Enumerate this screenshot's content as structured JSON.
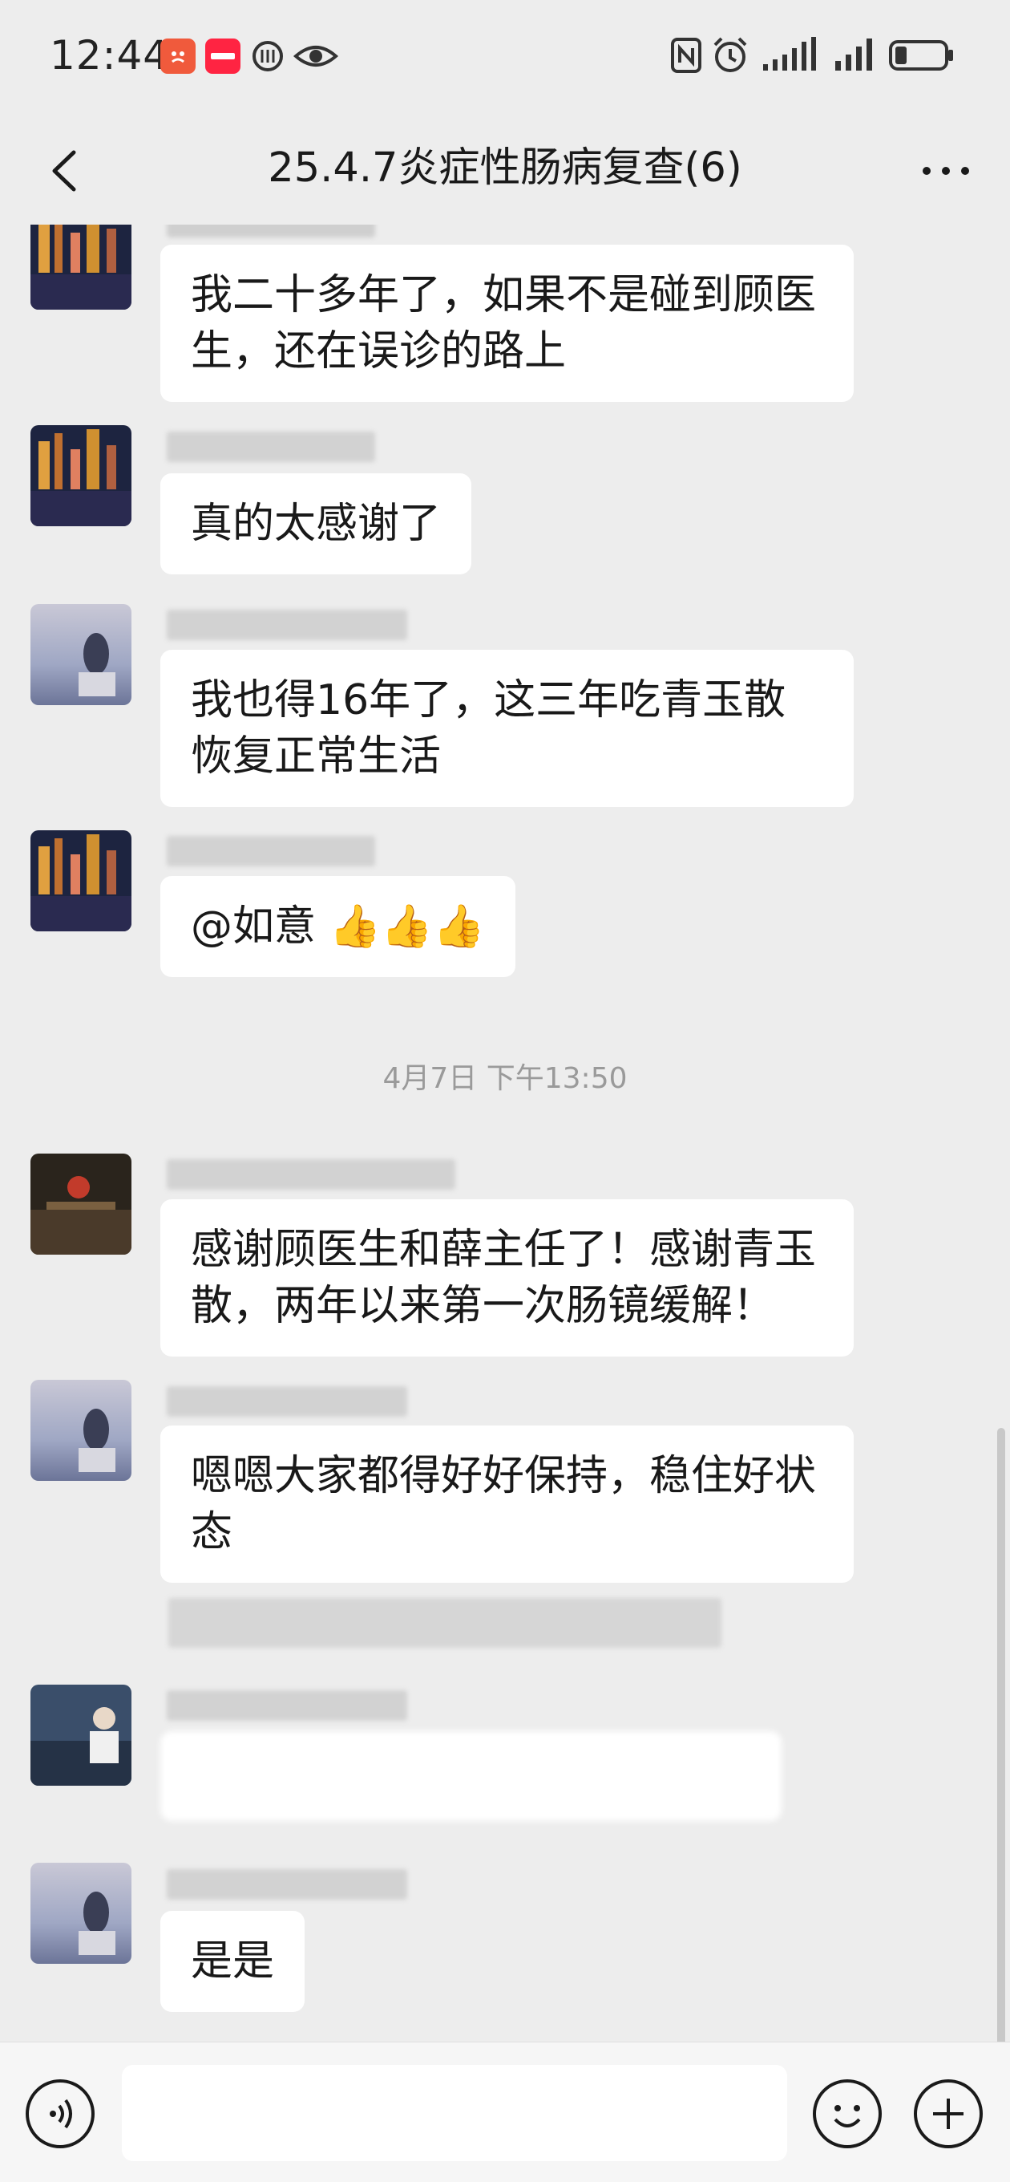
{
  "status_bar": {
    "time": "12:44",
    "notification_icons": [
      "app-notification-icon",
      "xiaohongshu-icon",
      "app-icon",
      "eye-icon"
    ],
    "right_icons": [
      "nfc-icon",
      "alarm-icon",
      "signal-icon",
      "signal-icon",
      "battery-icon"
    ]
  },
  "header": {
    "title": "25.4.7炎症性肠病复查(6)"
  },
  "messages": [
    {
      "text": "我二十多年了，如果不是碰到顾医生，还在误诊的路上"
    },
    {
      "text": "真的太感谢了"
    },
    {
      "text": "我也得16年了，这三年吃青玉散恢复正常生活"
    },
    {
      "text": "@如意 👍👍👍"
    },
    {
      "text": "感谢顾医生和薛主任了！感谢青玉散，两年以来第一次肠镜缓解！"
    },
    {
      "text": "嗯嗯大家都得好好保持，稳住好状态"
    },
    {
      "text": "是是"
    }
  ],
  "timestamp": "4月7日 下午13:50",
  "colors": {
    "background": "#ededed",
    "bubble": "#ffffff",
    "text": "#191919",
    "timestamp": "#9a9a9a"
  }
}
